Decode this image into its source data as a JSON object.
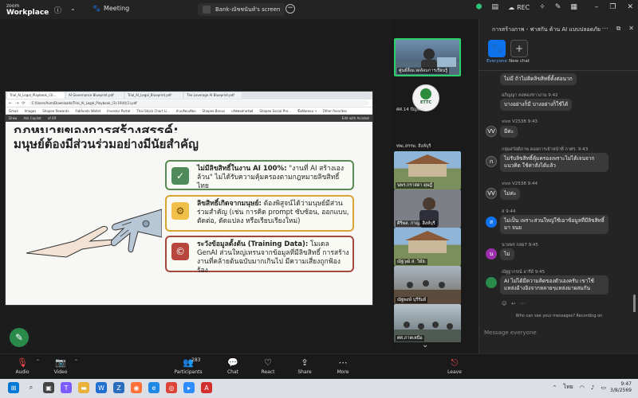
{
  "titlebar": {
    "logo_line1": "zoom",
    "logo_line2": "Workplace",
    "meeting_label": "Meeting",
    "share_label": "Bank-ณัชชนันท์'s screen",
    "rec_label": "REC"
  },
  "pdf": {
    "tabs": [
      "Trial_AI_Legal_Playbook_(3)...",
      "AI Governance Blueprint.pdf",
      "Trial_AI_Legal_Blueprint.pdf",
      "The Leverage AI Blueprint.pdf"
    ],
    "url": "C:/Users/Aum/Downloads/Trial_AI_Legal_Playbook_(3)-19(4)(1).pdf",
    "bookmarks": [
      "Gmail",
      "Images",
      "Shopee Rewards",
      "Fabfunds Wallet",
      "Investor Portal",
      "Thai Stock Chart Li...",
      "ตัวเปรียบเทียบ",
      "Shopee Bonus",
      "บริษัทหลักทรัพย์",
      "Shopee Social Pre...",
      "จิ๊ดต์ผิดชอบ ฯ",
      "Other favorites"
    ],
    "toolbar_items": [
      "Draw",
      "Ask Copilot",
      "of 49",
      "Edit with Acrobat"
    ]
  },
  "slide": {
    "title_line1": "กฎหมายของการสร้างสรรค์:",
    "title_line2": "มนุษย์ต้องมีส่วนร่วมอย่างมีนัยสำคัญ",
    "card1_bold": "ไม่มีลิขสิทธิ์ในงาน AI 100%:",
    "card1_text": " \"งานที่ AI สร้างเองล้วน\" ไม่ได้รับความคุ้มครองตามกฎหมายลิขสิทธิ์ไทย",
    "card2_bold": "ลิขสิทธิ์เกิดจากมนุษย์:",
    "card2_text": " ต้องพิสูจน์ได้ว่ามนุษย์มีส่วนร่วมสำคัญ (เช่น การคิด prompt ซับซ้อน, ออกแบบ, ตัดต่อ, ดัดแปลง หรือเรียบเรียงใหม่)",
    "card3_bold": "ระวังข้อมูลตั้งต้น (Training Data):",
    "card3_text": " โมเดล GenAI ส่วนใหญ่เทรนจากข้อมูลที่มีลิขสิทธิ์ การสร้างงานที่คล้ายต้นฉบับมากเกินไป มีความเสี่ยงถูกฟ้องร้อง"
  },
  "gallery": {
    "tile_names": [
      "ศูนย์สิ่งแวดล้อมการเรียนรู้",
      "ศศ.14 ปัญจพร",
      "ทพเ.สรรพ. สิงห์บุรี",
      "นพร.กราสดา ดุษฎี",
      "ศิริพล. กาญ. สิงห์บุรี",
      "ณัฐวุฒิ ส. วิมัย.",
      "ณัฐพงษ์ บุรีรัมย์",
      "ศศ.ภาคเหนือ"
    ],
    "ettc_label": "ETTC"
  },
  "chat": {
    "title": "การสร้างภาพ - ฟาสกัน ด้าน AI แบบปลอดภัย",
    "channels": [
      {
        "label": "Everyone"
      },
      {
        "label": "New chat"
      }
    ],
    "messages": [
      {
        "sender": "",
        "text": "ไม่มี ถ้าไม่ติดลิขสิทธิ์ตั้งต่อนาก",
        "avatar": "",
        "avatar_color": ""
      },
      {
        "sender": "อภิญญา คงทองชาวงาน 9:42",
        "text": "บางอย่างก็มี บางอย่างก็ใช้ได้",
        "avatar": "",
        "avatar_color": ""
      },
      {
        "sender": "vivo V2538 9:43",
        "text": "มีค่ะ",
        "avatar": "VV",
        "avatar_color": "#3b3b3b"
      },
      {
        "sender": "กลุ่มสวัสดิภาพ คอลการเจ้าหน้าที่ กาศร. 9:43",
        "text": "ไม่รับลิขสิทธิ์คุ้มครองเพราะไม่ได้เจนจากแนวคิด ใช้ค่าสั่งได้แล้ว",
        "avatar": "ก",
        "avatar_color": "#3b3b3b"
      },
      {
        "sender": "vivo V2538 9:44",
        "text": "ไม่ค่ะ",
        "avatar": "VV",
        "avatar_color": "#3b3b3b"
      },
      {
        "sender": "ส 9:44",
        "text": "ไม่เป็น เพราะส่วนใหญ่ใช้เอาข้อมูลที่มีลิขสิทธิ์มา จนย",
        "avatar": "ส",
        "avatar_color": "#0e72ed"
      },
      {
        "sender": "นายพร กลย7 9:45",
        "text": "ไม่",
        "avatar": "น",
        "avatar_color": "#9b2fae"
      },
      {
        "sender": "ณัฐฐากรณ์ อารีย์ 9:45",
        "text": "AI ไม่ได้มีความคิดของตัวเองครับ เขาใช้แหล่งอ้างอิงจากหลายๆแหล่งมาผสมกัน",
        "avatar": "",
        "avatar_color": "#2a8a4a"
      }
    ],
    "notice": "Who can see your messages? Recording on",
    "input_placeholder": "Message everyone"
  },
  "toolbar": {
    "audio": "Audio",
    "video": "Video",
    "participants": "Participants",
    "participants_count": "283",
    "chat": "Chat",
    "react": "React",
    "share": "Share",
    "more": "More",
    "leave": "Leave"
  },
  "taskbar": {
    "lang": "ไทย",
    "time": "9:47",
    "date": "3/8/2569"
  }
}
